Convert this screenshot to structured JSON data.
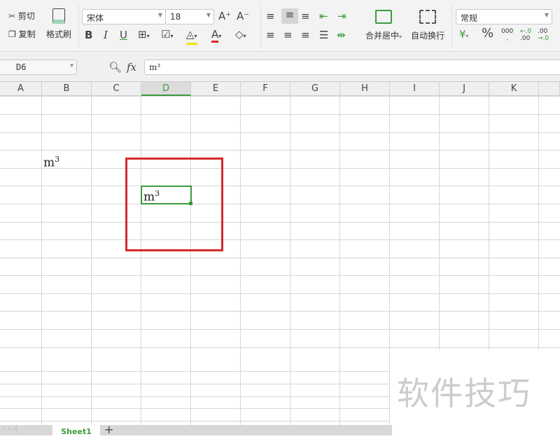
{
  "ribbon": {
    "cut": "剪切",
    "copy": "复制",
    "format_painter": "格式刷",
    "font_name": "宋体",
    "font_size": "18",
    "merge_center": "合并居中",
    "wrap_text": "自动换行",
    "number_format": "常规",
    "thousands": "000",
    "dec_inc_top": "←.0",
    "dec_inc_bottom": ".00",
    "dec_dec_top": ".00",
    "dec_dec_bottom": "→.0"
  },
  "formula_bar": {
    "name_box": "D6",
    "fx": "fx",
    "content": "m³"
  },
  "columns": [
    "A",
    "B",
    "C",
    "D",
    "E",
    "F",
    "G",
    "H",
    "I",
    "J",
    "K"
  ],
  "selected_column": "D",
  "cells": {
    "B4": {
      "base": "m",
      "sup": "3"
    },
    "D6": {
      "base": "m",
      "sup": "3"
    }
  },
  "sheet_tabs": [
    "Sheet1"
  ],
  "add_sheet": "+",
  "watermark": "软件技巧",
  "colors": {
    "accent": "#3c9a3c",
    "highlight_box": "#d42a2a"
  }
}
